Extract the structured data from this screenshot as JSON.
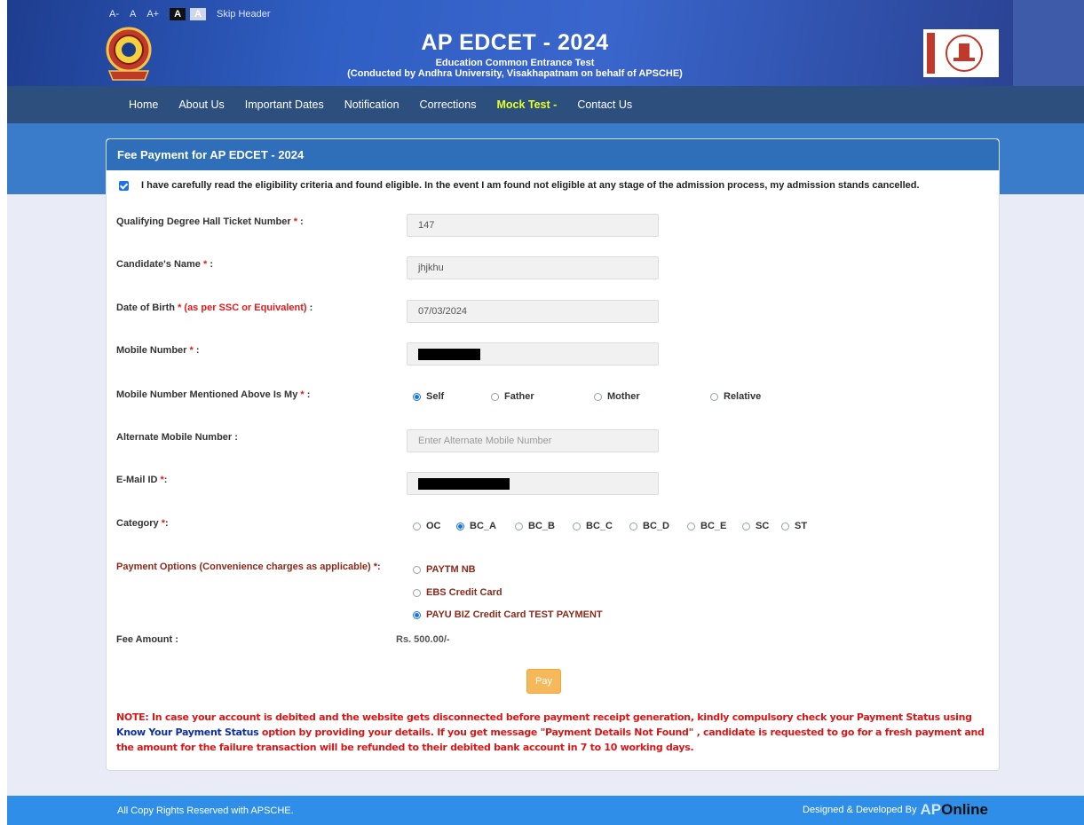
{
  "accessibility": {
    "font_decrease": "A-",
    "font_normal": "A",
    "font_increase": "A+",
    "theme_dark": "A",
    "theme_light": "A",
    "skip_header": "Skip Header"
  },
  "header": {
    "title": "AP EDCET - 2024",
    "subtitle": "Education Common Entrance Test",
    "conducted_by": "(Conducted by Andhra University, Visakhapatnam on behalf of APSCHE)",
    "right_logo_text": "APSCHE"
  },
  "nav": {
    "items": [
      {
        "label": "Home"
      },
      {
        "label": "About Us"
      },
      {
        "label": "Important Dates"
      },
      {
        "label": "Notification"
      },
      {
        "label": "Corrections"
      },
      {
        "label": "Mock Test -"
      },
      {
        "label": "Contact Us"
      }
    ]
  },
  "form": {
    "title": "Fee Payment for AP EDCET - 2024",
    "eligibility_text": "I have carefully read the eligibility criteria and found eligible. In the event I am found not eligible at any stage of the admission process, my admission stands cancelled.",
    "hall_ticket_label": "Qualifying Degree Hall Ticket Number",
    "hall_ticket_value": "147",
    "name_label": "Candidate's Name",
    "name_value": "jhjkhu",
    "dob_label": "Date of Birth",
    "dob_note": "* (as per SSC or Equivalent)",
    "dob_value": "07/03/2024",
    "mobile_label": "Mobile Number",
    "mobile_owner_label": "Mobile Number Mentioned Above Is My",
    "mobile_owner_options": [
      "Self",
      "Father",
      "Mother",
      "Relative"
    ],
    "mobile_owner_selected": "Self",
    "alt_mobile_label": "Alternate Mobile Number :",
    "alt_mobile_placeholder": "Enter Alternate Mobile Number",
    "email_label": "E-Mail ID",
    "category_label": "Category",
    "category_options": [
      "OC",
      "BC_A",
      "BC_B",
      "BC_C",
      "BC_D",
      "BC_E",
      "SC",
      "ST"
    ],
    "category_selected": "BC_A",
    "payment_label": "Payment Options (Convenience charges as applicable)",
    "payment_options": [
      "PAYTM NB",
      "EBS Credit Card",
      "PAYU BIZ Credit Card TEST PAYMENT"
    ],
    "payment_selected": "PAYU BIZ Credit Card TEST PAYMENT",
    "fee_label": "Fee Amount :",
    "fee_value": "Rs. 500.00/-",
    "pay_button": "Pay",
    "required_mark": "*",
    "colon": ":",
    "note_part1": "NOTE: In case your account is debited and the website gets disconnected before payment receipt generation, kindly compulsory check your Payment Status using ",
    "note_link": "Know Your Payment Status",
    "note_part2": " option by providing your details. If you get message \"Payment Details Not Found\" , candidate is requested to go for a fresh payment and the amount for the failure transaction will be refunded to their debited bank account in 7 to 10 working days."
  },
  "footer": {
    "copyright": "All Copy Rights Reserved with APSCHE.",
    "designed_by": "Designed & Developed By",
    "brand_ap": "AP",
    "brand_online": "Online"
  },
  "colors": {
    "header": "#2f5fc4",
    "navbar": "#2c4f7e",
    "card_header": "#2f6fba",
    "active_nav": "#e8ff2a",
    "pay_button": "#f5b85b",
    "note": "#d71818",
    "footer": "#2f8fe8"
  }
}
